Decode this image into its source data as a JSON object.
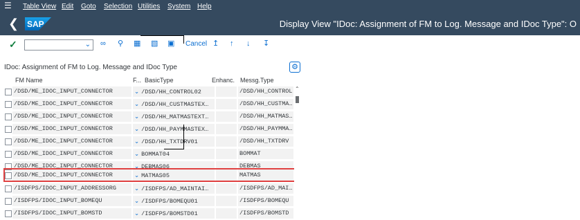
{
  "menubar": {
    "items": [
      "Table View",
      "Edit",
      "Goto",
      "Selection",
      "Utilities",
      "System",
      "Help"
    ]
  },
  "titlebar": {
    "logo_text": "SAP",
    "title": "Display View \"IDoc: Assignment of FM to Log. Message and IDoc Type\": O"
  },
  "toolbar": {
    "combo_value": "",
    "cancel_label": "Cancel",
    "icons": [
      "check-icon",
      "glasses-icon",
      "magnifier-icon",
      "select-all-icon",
      "select-block-icon",
      "deselect-all-icon",
      "first-page-icon",
      "previous-page-icon",
      "next-page-icon",
      "last-page-icon"
    ]
  },
  "table": {
    "title": "IDoc: Assignment of FM to Log. Message and IDoc Type",
    "headers": {
      "fm_name": "FM Name",
      "f": "F...",
      "basic_type": "BasicType",
      "enhanc": "Enhanc.",
      "messg_type": "Messg.Type"
    },
    "rows": [
      {
        "fm": "/DSD/ME_IDOC_INPUT_CONNECTOR",
        "basic": "/DSD/HH_CONTROL02",
        "enh": "",
        "msg": "/DSD/HH_CONTROL"
      },
      {
        "fm": "/DSD/ME_IDOC_INPUT_CONNECTOR",
        "basic": "/DSD/HH_CUSTMASTEX…",
        "enh": "",
        "msg": "/DSD/HH_CUSTMA…"
      },
      {
        "fm": "/DSD/ME_IDOC_INPUT_CONNECTOR",
        "basic": "/DSD/HH_MATMASTEXT…",
        "enh": "",
        "msg": "/DSD/HH_MATMAS…"
      },
      {
        "fm": "/DSD/ME_IDOC_INPUT_CONNECTOR",
        "basic": "/DSD/HH_PAYMMASTEX…",
        "enh": "",
        "msg": "/DSD/HH_PAYMMA…"
      },
      {
        "fm": "/DSD/ME_IDOC_INPUT_CONNECTOR",
        "basic": "/DSD/HH_TXTDRV01",
        "enh": "",
        "msg": "/DSD/HH_TXTDRV"
      },
      {
        "fm": "/DSD/ME_IDOC_INPUT_CONNECTOR",
        "basic": "BOMMAT04",
        "enh": "",
        "msg": "BOMMAT"
      },
      {
        "fm": "/DSD/ME_IDOC_INPUT_CONNECTOR",
        "basic": "DEBMAS06",
        "enh": "",
        "msg": "DEBMAS"
      },
      {
        "fm": "/DSD/ME_IDOC_INPUT_CONNECTOR",
        "basic": "MATMAS05",
        "enh": "",
        "msg": "MATMAS"
      },
      {
        "fm": "/ISDFPS/IDOC_INPUT_ADDRESSORG",
        "basic": "/ISDFPS/AD_MAINTAI…",
        "enh": "",
        "msg": "/ISDFPS/AD_MAI…"
      },
      {
        "fm": "/ISDFPS/IDOC_INPUT_BOMEQU",
        "basic": "/ISDFPS/BOMEQU01",
        "enh": "",
        "msg": "/ISDFPS/BOMEQU"
      },
      {
        "fm": "/ISDFPS/IDOC_INPUT_BOMSTD",
        "basic": "/ISDFPS/BOMSTD01",
        "enh": "",
        "msg": "/ISDFPS/BOMSTD"
      }
    ],
    "highlighted_row": 7
  },
  "colors": {
    "shell": "#354a5f",
    "accent": "#0a6ed1",
    "highlight": "#e04040",
    "check": "#107e3e"
  }
}
